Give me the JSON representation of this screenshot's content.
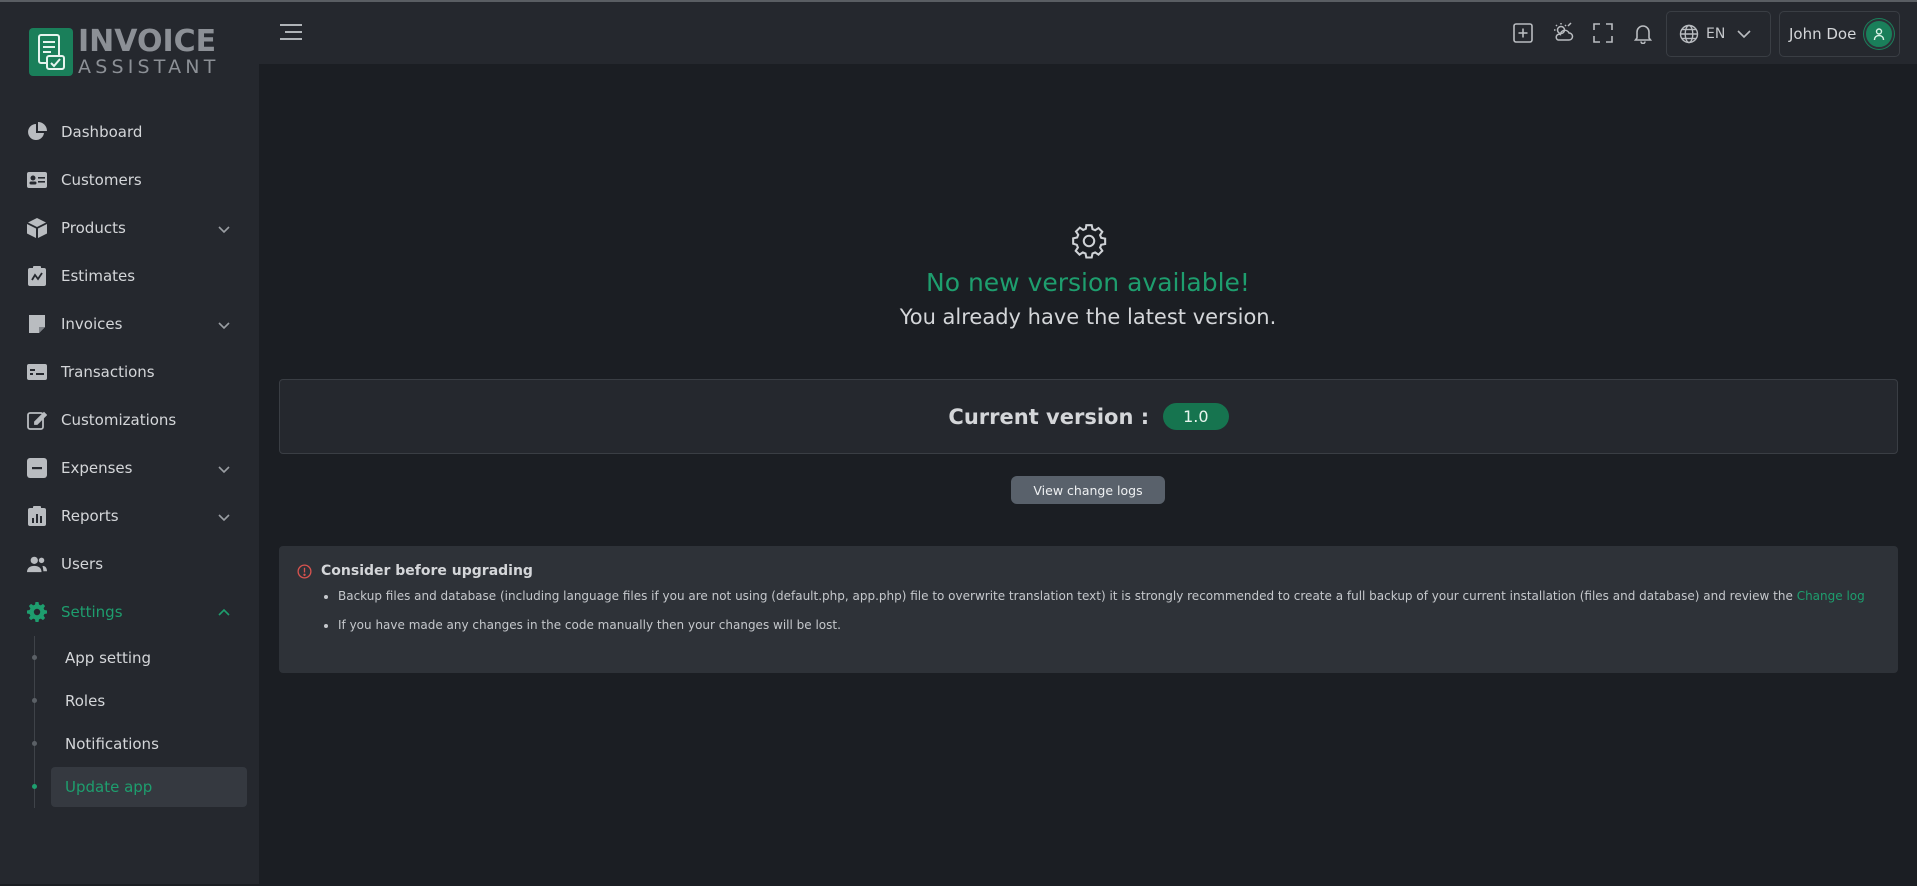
{
  "logo": {
    "line1": "INVOICE",
    "line2": "ASSISTANT"
  },
  "sidebar": {
    "items": [
      {
        "label": "Dashboard",
        "icon": "chart-pie-icon",
        "has_children": false
      },
      {
        "label": "Customers",
        "icon": "id-card-icon",
        "has_children": false
      },
      {
        "label": "Products",
        "icon": "box-icon",
        "has_children": true
      },
      {
        "label": "Estimates",
        "icon": "clipboard-icon",
        "has_children": false
      },
      {
        "label": "Invoices",
        "icon": "invoice-icon",
        "has_children": true
      },
      {
        "label": "Transactions",
        "icon": "receipt-icon",
        "has_children": false
      },
      {
        "label": "Customizations",
        "icon": "edit-icon",
        "has_children": false
      },
      {
        "label": "Expenses",
        "icon": "minus-square-icon",
        "has_children": true
      },
      {
        "label": "Reports",
        "icon": "report-icon",
        "has_children": true
      },
      {
        "label": "Users",
        "icon": "users-icon",
        "has_children": false
      },
      {
        "label": "Settings",
        "icon": "gear-icon",
        "has_children": true,
        "expanded": true,
        "active": true
      }
    ],
    "settings_children": [
      {
        "label": "App setting"
      },
      {
        "label": "Roles"
      },
      {
        "label": "Notifications"
      },
      {
        "label": "Update app",
        "active": true
      }
    ]
  },
  "header": {
    "language": "EN",
    "user_name": "John Doe"
  },
  "main": {
    "status_title": "No new version available!",
    "status_subtitle": "You already have the latest version.",
    "current_version_label": "Current version :",
    "current_version": "1.0",
    "changelog_button": "View change logs",
    "notice": {
      "title": "Consider before upgrading",
      "item1_text": "Backup files and database (including language files if you are not using (default.php, app.php) file to overwrite translation text) it is strongly recommended to create a full backup of your current installation (files and database) and review the",
      "item1_link": "Change log",
      "item2_text": "If you have made any changes in the code manually then your changes will be lost."
    }
  },
  "colors": {
    "accent": "#1e9e6e",
    "background": "#1b1e23",
    "panel": "#25282e",
    "warning": "#d9534f"
  }
}
